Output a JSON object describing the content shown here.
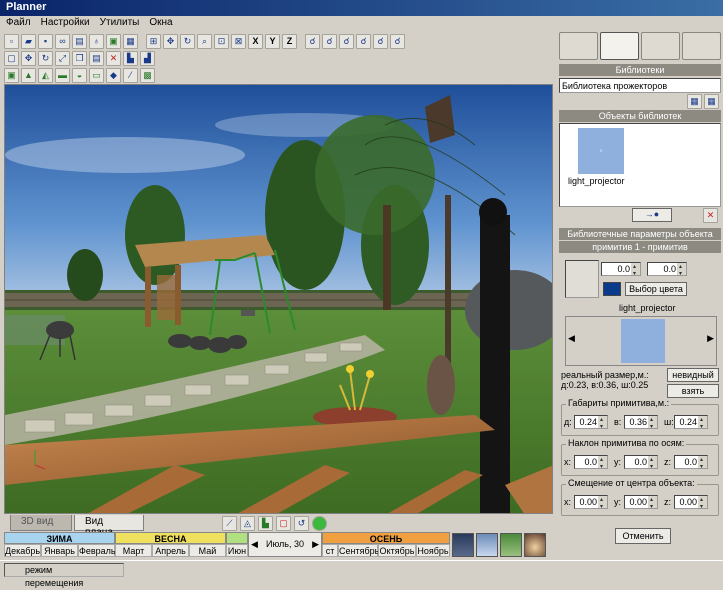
{
  "window": {
    "title": "Planner"
  },
  "menu": [
    "Файл",
    "Настройки",
    "Утилиты",
    "Окна"
  ],
  "toolbar": {
    "x_label": "X",
    "y_label": "Y",
    "z_label": "Z"
  },
  "view_tabs": {
    "view3d": "3D вид",
    "plan": "Вид плана"
  },
  "seasons": [
    {
      "name": "ЗИМА",
      "color": "#a8d4f0"
    },
    {
      "name": "ВЕСНА",
      "color": "#f0e060"
    },
    {
      "name": "ОСЕНЬ",
      "color": "#f0a040"
    }
  ],
  "months_left": [
    "Декабрь",
    "Январь",
    "Февраль",
    "Март",
    "Апрель",
    "Май",
    "Июн"
  ],
  "months_right": [
    "ст",
    "Сентябрь",
    "Октябрь",
    "Ноябрь"
  ],
  "date_display": "Июль, 30",
  "status": "режим перемещения",
  "panel": {
    "libraries_header": "Библиотеки",
    "library_select": "Библиотека прожекторов",
    "library_objects_header": "Объекты библиотек",
    "object_name": "light_projector",
    "params_header": "Библиотечные параметры объекта",
    "primitive_header": "примитив 1 - примитив",
    "spin1": "0.0",
    "spin2": "0.0",
    "color_button": "Выбор цвета",
    "preview_name": "light_projector",
    "real_size_label": "реальный размер,м.:",
    "real_size_value": "д:0.23, в:0.36, ш:0.25",
    "invisible_button": "невидный",
    "take_button": "взять",
    "dims_group": "Габариты примитива,м.:",
    "dims": {
      "d_label": "д:",
      "d": "0.24",
      "v_label": "в:",
      "v": "0.36",
      "sh_label": "ш:",
      "sh": "0.24"
    },
    "tilt_group": "Наклон примитива по осям:",
    "tilt": {
      "x_label": "x:",
      "x": "0.0",
      "y_label": "y:",
      "y": "0.0",
      "z_label": "z:",
      "z": "0.0"
    },
    "offset_group": "Смещение от центра объекта:",
    "offset": {
      "x_label": "x:",
      "x": "0.00",
      "y_label": "y:",
      "y": "0.00",
      "z_label": "z:",
      "z": "0.00"
    },
    "cancel_button": "Отменить"
  }
}
